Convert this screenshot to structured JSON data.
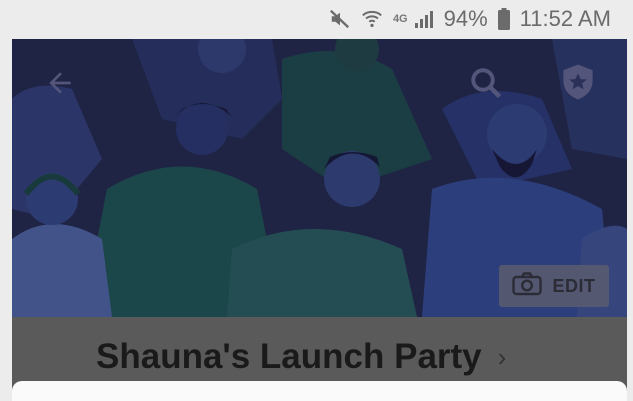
{
  "status_bar": {
    "network_label": "4G",
    "battery": "94%",
    "time": "11:52 AM"
  },
  "cover": {
    "edit_label": "EDIT"
  },
  "event": {
    "title": "Shauna's Launch Party",
    "chevron": "›"
  },
  "colors": {
    "cover_bg": "#2a3057",
    "overlay": "#5a5a5a"
  }
}
